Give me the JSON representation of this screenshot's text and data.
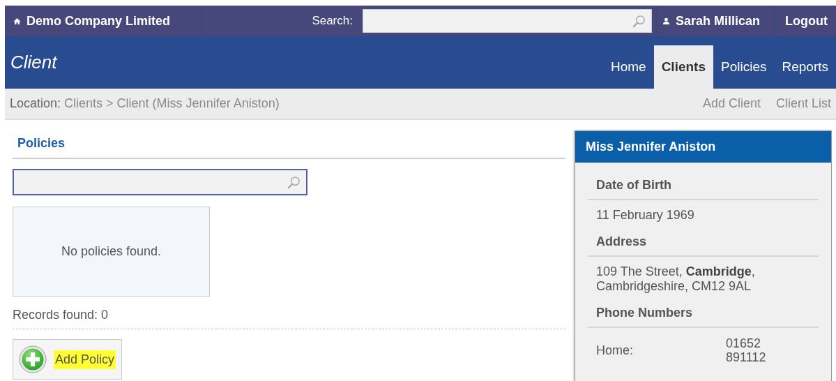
{
  "top_bar": {
    "company": "Demo Company Limited",
    "search_label": "Search:",
    "user": "Sarah Millican",
    "logout": "Logout"
  },
  "header": {
    "title": "Client",
    "tabs": [
      {
        "label": "Home",
        "selected": false
      },
      {
        "label": "Clients",
        "selected": true
      },
      {
        "label": "Policies",
        "selected": false
      },
      {
        "label": "Reports",
        "selected": false
      }
    ]
  },
  "breadcrumb": {
    "label": "Location:",
    "path": "Clients > Client (Miss Jennifer Aniston)",
    "actions": [
      "Add Client",
      "Client List"
    ]
  },
  "policies": {
    "title": "Policies",
    "empty_message": "No policies found.",
    "records": "Records found: 0",
    "add_button": {
      "label": "Add Policy",
      "highlighted": true
    }
  },
  "client_panel": {
    "title": "Miss Jennifer Aniston",
    "sections": [
      {
        "heading": "Date of Birth",
        "kind": "text",
        "value": "11 February 1969"
      },
      {
        "heading": "Address",
        "kind": "text",
        "value": "109 The Street, **Cambridge**,\nCambridgeshire, CM12 9AL"
      },
      {
        "heading": "Phone Numbers",
        "kind": "pairs",
        "rows": [
          {
            "label": "Home:",
            "value": "01652\n891112"
          }
        ]
      }
    ]
  }
}
